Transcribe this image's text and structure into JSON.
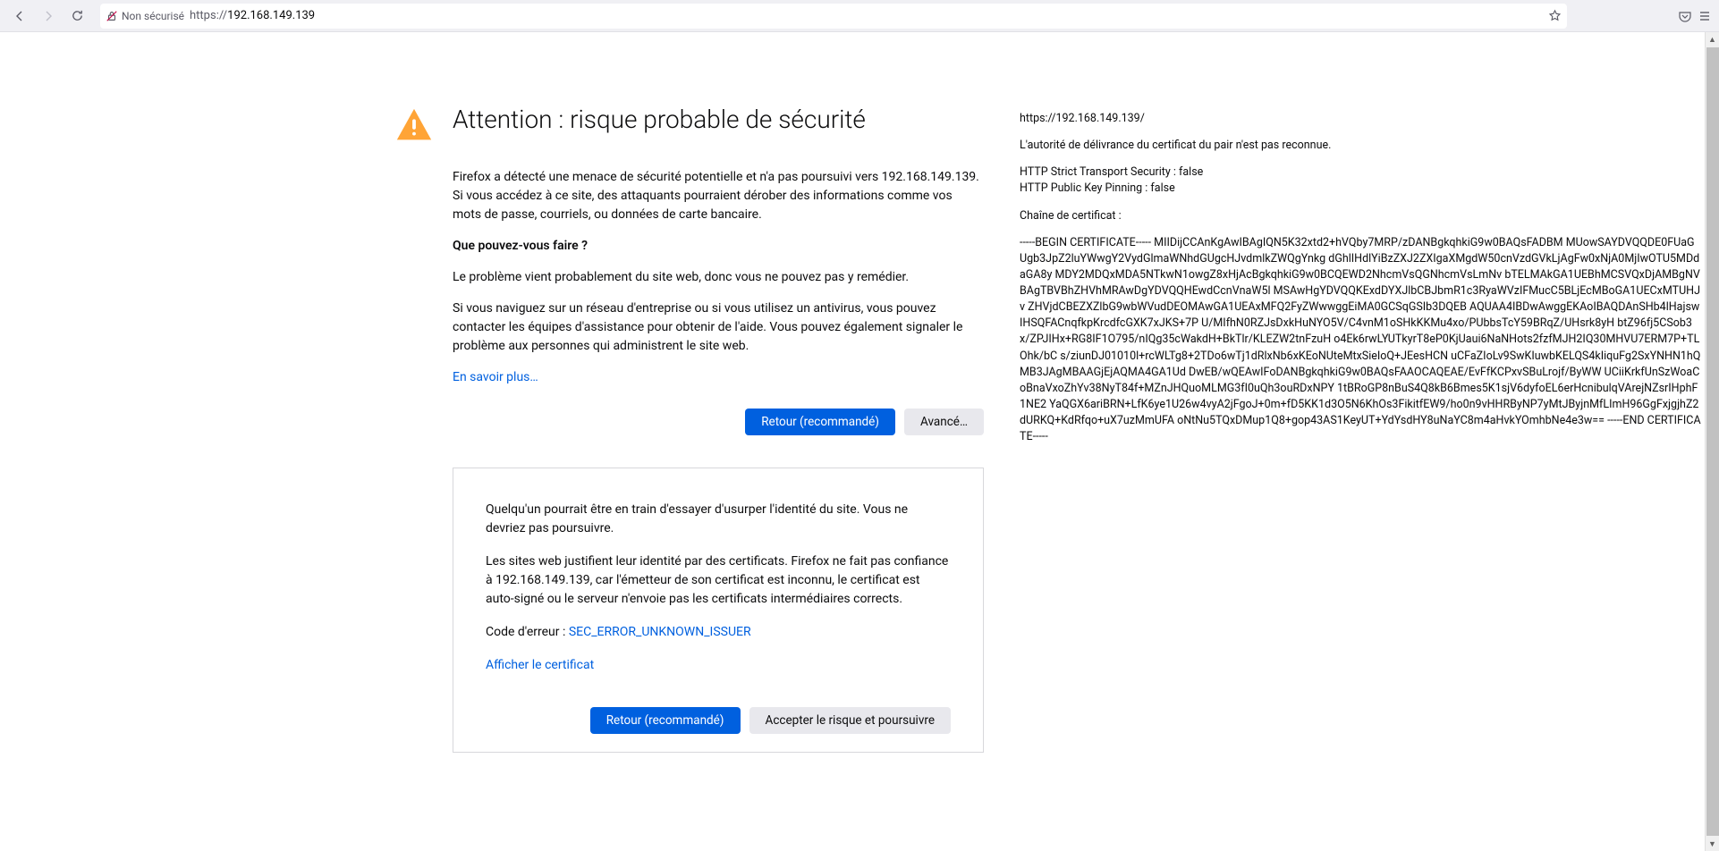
{
  "toolbar": {
    "security_label": "Non sécurisé",
    "url_scheme": "https://",
    "url_host": "192.168.149.139"
  },
  "error": {
    "title": "Attention : risque probable de sécurité",
    "intro": "Firefox a détecté une menace de sécurité potentielle et n'a pas poursuivi vers 192.168.149.139. Si vous accédez à ce site, des attaquants pourraient dérober des informations comme vos mots de passe, courriels, ou données de carte bancaire.",
    "what_heading": "Que pouvez-vous faire ?",
    "what_p1": "Le problème vient probablement du site web, donc vous ne pouvez pas y remédier.",
    "what_p2": "Si vous naviguez sur un réseau d'entreprise ou si vous utilisez un antivirus, vous pouvez contacter les équipes d'assistance pour obtenir de l'aide. Vous pouvez également signaler le problème aux personnes qui administrent le site web.",
    "learn_more": "En savoir plus…",
    "btn_back": "Retour (recommandé)",
    "btn_advanced": "Avancé…"
  },
  "advanced": {
    "p1": "Quelqu'un pourrait être en train d'essayer d'usurper l'identité du site. Vous ne devriez pas poursuivre.",
    "p2": "Les sites web justifient leur identité par des certificats. Firefox ne fait pas confiance à 192.168.149.139, car l'émetteur de son certificat est inconnu, le certificat est auto-signé ou le serveur n'envoie pas les certificats intermédiaires corrects.",
    "error_code_label": "Code d'erreur : ",
    "error_code": "SEC_ERROR_UNKNOWN_ISSUER",
    "view_cert": "Afficher le certificat",
    "btn_back": "Retour (recommandé)",
    "btn_accept": "Accepter le risque et poursuivre"
  },
  "cert": {
    "url": "https://192.168.149.139/",
    "issuer_line": "L'autorité de délivrance du certificat du pair n'est pas reconnue.",
    "hsts": "HTTP Strict Transport Security : false",
    "hpkp": "HTTP Public Key Pinning : false",
    "chain_label": "Chaîne de certificat :",
    "pem": "-----BEGIN CERTIFICATE-----\nMIIDijCCAnKgAwIBAgIQN5K32xtd2+hVQby7MRP/zDANBgkqhkiG9w0BAQsFADBM\nMUowSAYDVQQDE0FUaGUgb3JpZ2luYWwgY2VydGlmaWNhdGUgcHJvdmlkZWQgYnkg\ndGhlIHdlYiBzZXJ2ZXIgaXMgdW50cnVzdGVkLjAgFw0xNjA0MjIwOTU5MDdaGA8y\nMDY2MDQxMDA5NTkwN1owgZ8xHjAcBgkqhkiG9w0BCQEWD2NhcmVsQGNhcmVsLmNv\nbTELMAkGA1UEBhMCSVQxDjAMBgNVBAgTBVBhZHVhMRAwDgYDVQQHEwdCcnVnaW5l\nMSAwHgYDVQQKExdDYXJlbCBJbmR1c3RyaWVzIFMucC5BLjEcMBoGA1UECxMTUHJv\nZHVjdCBEZXZlbG9wbWVudDEOMAwGA1UEAxMFQ2FyZWwwggEiMA0GCSqGSIb3DQEB\nAQUAA4IBDwAwggEKAoIBAQDAnSHb4lHajswIHSQFACnqfkpKrcdfcGXK7xJKS+7P\nU/MIfhN0RZJsDxkHuNYO5V/C4vnM1oSHkKKMu4xo/PUbbsTcY59BRqZ/UHsrk8yH\nbtZ96fj5CSob3x/ZPJIHx+RG8IF1O795/nIQg35cWakdH+BkTlr/KLEZW2tnFzuH\no4Ek6rwLYUTkyrT8eP0KjUaui6NaNHots2fzfMJH2IQ30MHVU7ERM7P+TLOhk/bC\ns/ziunDJ01010l+rcWLTg8+2TDo6wTj1dRlxNb6xKEoNUteMtxSieIoQ+JEesHCN\nuCFaZIoLv9SwKIuwbKELQS4kIiquFg2SxYNHN1hQMB3JAgMBAAGjEjAQMA4GA1Ud\nDwEB/wQEAwIFoDANBgkqhkiG9w0BAQsFAAOCAQEAE/EvFfKCPxvSBuLrojf/ByWW\nUCiiKrkfUnSzWoaCoBnaVxoZhYv38NyT84f+MZnJHQuoMLMG3fI0uQh3ouRDxNPY\n1tBRoGP8nBuS4Q8kB6Bmes5K1sjV6dyfoEL6erHcnibulqVArejNZsrIHphF1NE2\nYaQGX6ariBRN+LfK6ye1U26w4vyA2jFgoJ+0m+fD5KK1d3O5N6KhOs3FikitfEW9/ho0n9vHHRByNP7yMtJByjnMfLImH96GgFxjgjhZ2dURKQ+KdRfqo+uX7uzMmUFA\noNtNu5TQxDMup1Q8+gop43AS1KeyUT+YdYsdHY8uNaYC8m4aHvkYOmhbNe4e3w==\n-----END CERTIFICATE-----"
  }
}
